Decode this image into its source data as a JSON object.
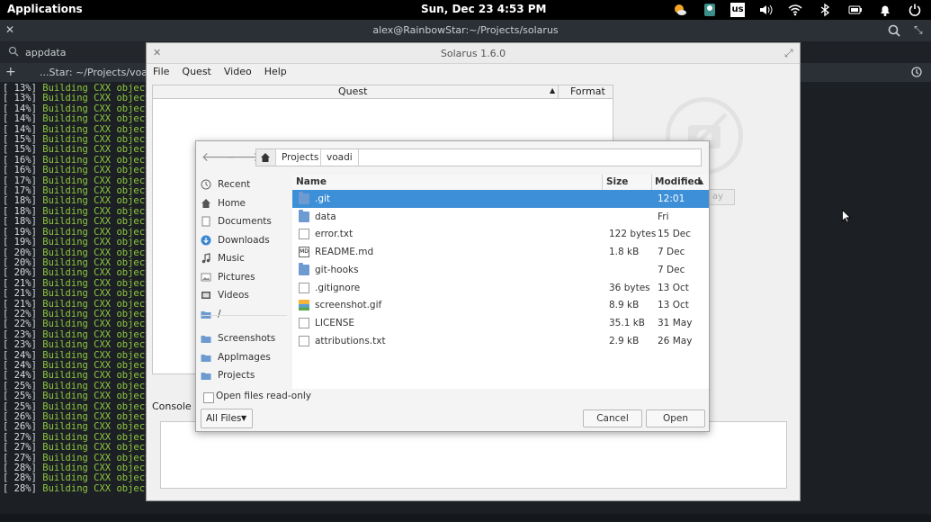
{
  "panel": {
    "apps_label": "Applications",
    "clock": "Sun, Dec 23   4:53 PM",
    "keyboard_layout": "us"
  },
  "terminal": {
    "title": "alex@RainbowStar:~/Projects/solarus",
    "search_value": "appdata",
    "tab_label": "...Star: ~/Projects/voadi",
    "lines": [
      {
        "pct": "[ 13%]",
        "txt": "Building CXX object"
      },
      {
        "pct": "[ 13%]",
        "txt": "Building CXX object"
      },
      {
        "pct": "[ 14%]",
        "txt": "Building CXX object"
      },
      {
        "pct": "[ 14%]",
        "txt": "Building CXX object"
      },
      {
        "pct": "[ 14%]",
        "txt": "Building CXX object"
      },
      {
        "pct": "[ 15%]",
        "txt": "Building CXX object"
      },
      {
        "pct": "[ 15%]",
        "txt": "Building CXX object"
      },
      {
        "pct": "[ 16%]",
        "txt": "Building CXX object"
      },
      {
        "pct": "[ 16%]",
        "txt": "Building CXX object"
      },
      {
        "pct": "[ 17%]",
        "txt": "Building CXX object"
      },
      {
        "pct": "[ 17%]",
        "txt": "Building CXX object"
      },
      {
        "pct": "[ 18%]",
        "txt": "Building CXX object"
      },
      {
        "pct": "[ 18%]",
        "txt": "Building CXX object"
      },
      {
        "pct": "[ 18%]",
        "txt": "Building CXX object"
      },
      {
        "pct": "[ 19%]",
        "txt": "Building CXX object"
      },
      {
        "pct": "[ 19%]",
        "txt": "Building CXX object"
      },
      {
        "pct": "[ 20%]",
        "txt": "Building CXX object"
      },
      {
        "pct": "[ 20%]",
        "txt": "Building CXX object"
      },
      {
        "pct": "[ 20%]",
        "txt": "Building CXX object"
      },
      {
        "pct": "[ 21%]",
        "txt": "Building CXX object"
      },
      {
        "pct": "[ 21%]",
        "txt": "Building CXX object"
      },
      {
        "pct": "[ 21%]",
        "txt": "Building CXX object"
      },
      {
        "pct": "[ 22%]",
        "txt": "Building CXX object"
      },
      {
        "pct": "[ 22%]",
        "txt": "Building CXX object"
      },
      {
        "pct": "[ 23%]",
        "txt": "Building CXX object"
      },
      {
        "pct": "[ 23%]",
        "txt": "Building CXX object"
      },
      {
        "pct": "[ 24%]",
        "txt": "Building CXX object"
      },
      {
        "pct": "[ 24%]",
        "txt": "Building CXX object"
      },
      {
        "pct": "[ 24%]",
        "txt": "Building CXX object"
      },
      {
        "pct": "[ 25%]",
        "txt": "Building CXX object"
      },
      {
        "pct": "[ 25%]",
        "txt": "Building CXX object"
      },
      {
        "pct": "[ 25%]",
        "txt": "Building CXX object"
      },
      {
        "pct": "[ 26%]",
        "txt": "Building CXX object"
      },
      {
        "pct": "[ 26%]",
        "txt": "Building CXX object"
      },
      {
        "pct": "[ 27%]",
        "txt": "Building CXX object"
      },
      {
        "pct": "[ 27%]",
        "txt": "Building CXX object"
      },
      {
        "pct": "[ 27%]",
        "txt": "Building CXX object"
      },
      {
        "pct": "[ 28%]",
        "txt": "Building CXX object"
      },
      {
        "pct": "[ 28%]",
        "txt": "Building CXX object"
      },
      {
        "pct": "[ 28%]",
        "txt": "Building CXX object"
      }
    ]
  },
  "solarus": {
    "title": "Solarus 1.6.0",
    "menu": [
      "File",
      "Quest",
      "Video",
      "Help"
    ],
    "quest_columns": {
      "quest": "Quest",
      "format": "Format"
    },
    "play_label": "ay",
    "console_label": "Console"
  },
  "dialog": {
    "breadcrumbs": [
      "Projects",
      "voadi"
    ],
    "places": [
      {
        "label": "Recent",
        "icon": "clock-icon"
      },
      {
        "label": "Home",
        "icon": "home-icon"
      },
      {
        "label": "Documents",
        "icon": "document-icon"
      },
      {
        "label": "Downloads",
        "icon": "download-icon"
      },
      {
        "label": "Music",
        "icon": "music-icon"
      },
      {
        "label": "Pictures",
        "icon": "picture-icon"
      },
      {
        "label": "Videos",
        "icon": "video-icon"
      },
      {
        "label": "/",
        "icon": "folder-icon"
      }
    ],
    "bookmarks": [
      {
        "label": "Screenshots",
        "icon": "folder-icon"
      },
      {
        "label": "AppImages",
        "icon": "folder-icon"
      },
      {
        "label": "Projects",
        "icon": "folder-icon"
      }
    ],
    "columns": {
      "name": "Name",
      "size": "Size",
      "modified": "Modified"
    },
    "files": [
      {
        "name": ".git",
        "size": "",
        "modified": "12:01",
        "kind": "folder",
        "selected": true
      },
      {
        "name": "data",
        "size": "",
        "modified": "Fri",
        "kind": "folder"
      },
      {
        "name": "error.txt",
        "size": "122 bytes",
        "modified": "15 Dec",
        "kind": "doc"
      },
      {
        "name": "README.md",
        "size": "1.8 kB",
        "modified": "7 Dec",
        "kind": "readme"
      },
      {
        "name": "git-hooks",
        "size": "",
        "modified": "7 Dec",
        "kind": "folder"
      },
      {
        "name": ".gitignore",
        "size": "36 bytes",
        "modified": "13 Oct",
        "kind": "doc"
      },
      {
        "name": "screenshot.gif",
        "size": "8.9 kB",
        "modified": "13 Oct",
        "kind": "img"
      },
      {
        "name": "LICENSE",
        "size": "35.1 kB",
        "modified": "31 May",
        "kind": "doc"
      },
      {
        "name": "attributions.txt",
        "size": "2.9 kB",
        "modified": "26 May",
        "kind": "doc"
      }
    ],
    "read_only_label": "Open files read-only",
    "read_only_checked": false,
    "filter_value": "All Files",
    "cancel_label": "Cancel",
    "open_label": "Open"
  }
}
